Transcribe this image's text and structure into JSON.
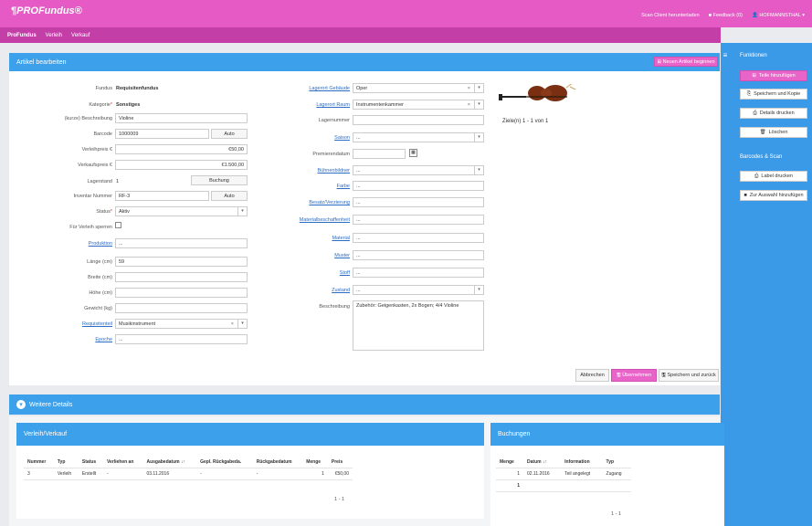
{
  "app": {
    "logo": "¶PROFundus®"
  },
  "topbar": {
    "items": [
      "Scan Client herunterladen",
      "Feedback (0)",
      "HOFMANNSTHAL"
    ]
  },
  "nav": {
    "tabs": [
      "ProFundus",
      "Verleih",
      "Verkauf"
    ]
  },
  "page": {
    "title": "Artikel bearbeiten",
    "new_button": "Neuen Artikel beginnen"
  },
  "form": {
    "fundus": {
      "label": "Fundus",
      "value": "Requisitenfundus"
    },
    "kategorie": {
      "label": "Kategorie",
      "value": "Sonstiges"
    },
    "kurz": {
      "label": "(kurze) Beschreibung",
      "value": "Violine"
    },
    "barcode": {
      "label": "Barcode",
      "value": "1000009",
      "button": "Auto"
    },
    "verleihpreis": {
      "label": "Verleihpreis €",
      "value": "€50,00"
    },
    "verkaufspreis": {
      "label": "Verkaufspreis €",
      "value": "€1.500,00"
    },
    "lagerstand": {
      "label": "Lagerstand",
      "value": "1",
      "button": "Buchung"
    },
    "inventar": {
      "label": "Inventar Nummer",
      "value": "RF-3",
      "button": "Auto"
    },
    "status": {
      "label": "Status",
      "value": "Aktiv"
    },
    "sperren": {
      "label": "Für Verleih sperren"
    },
    "produktion": {
      "label": "Produktion",
      "placeholder": "..."
    },
    "laenge": {
      "label": "Länge (cm)",
      "value": "59"
    },
    "breite": {
      "label": "Breite (cm)"
    },
    "hoehe": {
      "label": "Höhe (cm)"
    },
    "gewicht": {
      "label": "Gewicht (kg)"
    },
    "requisitenteil": {
      "label": "Requisitenteil",
      "value": "Musikinstrument"
    },
    "epoche": {
      "label": "Epoche",
      "placeholder": "..."
    },
    "lagerort_gebaeude": {
      "label": "Lagerort Gebäude",
      "value": "Oper"
    },
    "lagerort_raum": {
      "label": "Lagerort Raum",
      "value": "Instrumentenkammer"
    },
    "lagernummer": {
      "label": "Lagernummer"
    },
    "saison": {
      "label": "Saison",
      "placeholder": "..."
    },
    "premierendatum": {
      "label": "Premierendatum"
    },
    "buehnenbildner": {
      "label": "Bühnenbildner",
      "placeholder": "..."
    },
    "farbe": {
      "label": "Farbe",
      "placeholder": "..."
    },
    "besatz": {
      "label": "Besatz/Verzierung",
      "placeholder": "..."
    },
    "materialbeschaffenheit": {
      "label": "Materialbeschaffenheit",
      "placeholder": "..."
    },
    "material": {
      "label": "Material",
      "placeholder": "..."
    },
    "muster": {
      "label": "Muster",
      "placeholder": "..."
    },
    "stoff": {
      "label": "Stoff",
      "placeholder": "..."
    },
    "zustand": {
      "label": "Zustand",
      "placeholder": "..."
    },
    "beschreibung": {
      "label": "Beschreibung",
      "value": "Zubehör: Geigenkasten, 2x Bogen; 4/4 Violine"
    },
    "images_count": "Ziele(n) 1 - 1 von 1"
  },
  "actions": {
    "cancel": "Abbrechen",
    "apply": "Übernehmen",
    "save_back": "Speichern und zurück"
  },
  "details": {
    "title": "Weitere Details"
  },
  "verleih": {
    "title": "Verleih/Verkauf",
    "columns": [
      "Nummer",
      "Typ",
      "Status",
      "Verliehen an",
      "Ausgabedatum ↓↑",
      "Gepl. Rückgabeda.",
      "Rückgabedatum",
      "Menge",
      "Preis"
    ],
    "rows": [
      [
        "3",
        "Verleih",
        "Erstellt",
        "-",
        "03.11.2016",
        "-",
        "-",
        "1",
        "€50,00"
      ]
    ],
    "pager": "1 - 1"
  },
  "buchungen": {
    "title": "Buchungen",
    "columns": [
      "Menge",
      "Datum ↓↑",
      "Information",
      "Typ"
    ],
    "rows": [
      [
        "1",
        "02.11.2016",
        "Teil angelegt",
        "Zugang"
      ]
    ],
    "sum": "1",
    "pager": "1 - 1"
  },
  "sidebar": {
    "funktionen": "Funktionen",
    "buttons": [
      "Teile hinzufügen",
      "Speichern und Kopie",
      "Details drucken",
      "Löschen"
    ],
    "barcodes": "Barcodes & Scan",
    "buttons2": [
      "Label drucken",
      "Zur Auswahl hinzufügen"
    ]
  },
  "colors": {
    "topbar": "#e55ac4",
    "subnav": "#c43ea8",
    "accent": "#3ca0ea",
    "pink_button": "#e864c9"
  }
}
